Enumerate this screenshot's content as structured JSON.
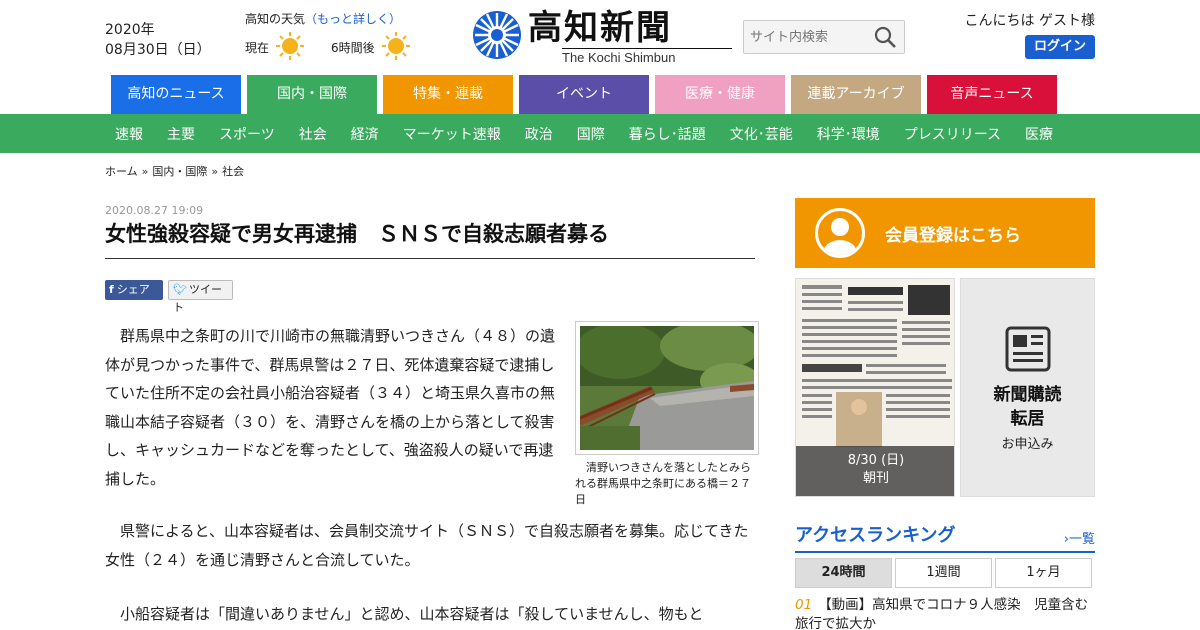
{
  "header": {
    "date_year": "2020年",
    "date_day": "08月30日（日）",
    "weather_title": "高知の天気",
    "weather_more": "（もっと詳しく）",
    "weather_now": "現在",
    "weather_later": "6時間後",
    "weather_icon": "sun-icon",
    "logo_text": "高知新聞",
    "logo_sub": "The Kochi Shimbun",
    "search_placeholder": "サイト内検索",
    "greeting": "こんにちは ゲスト様",
    "login_label": "ログイン"
  },
  "categories": [
    {
      "label": "高知のニュース",
      "color": "#1a6fe8",
      "width": 130
    },
    {
      "label": "国内・国際",
      "color": "#3aaa5e",
      "width": 130
    },
    {
      "label": "特集・連載",
      "color": "#f29600",
      "width": 130
    },
    {
      "label": "イベント",
      "color": "#5a4ea8",
      "width": 130
    },
    {
      "label": "医療・健康",
      "color": "#f0a0c0",
      "width": 130
    },
    {
      "label": "連載アーカイブ",
      "color": "#c4a882",
      "width": 130
    },
    {
      "label": "音声ニュース",
      "color": "#d9103a",
      "width": 130
    }
  ],
  "subnav": [
    "速報",
    "主要",
    "スポーツ",
    "社会",
    "経済",
    "マーケット速報",
    "政治",
    "国際",
    "暮らし･話題",
    "文化･芸能",
    "科学･環境",
    "プレスリリース",
    "医療"
  ],
  "breadcrumb": [
    "ホーム",
    "国内・国際",
    "社会"
  ],
  "article": {
    "date": "2020.08.27 19:09",
    "title": "女性強殺容疑で男女再逮捕　ＳＮＳで自殺志願者募る",
    "share_fb": "シェア",
    "share_tw": "ツイート",
    "p1": "　群馬県中之条町の川で川崎市の無職清野いつきさん（４８）の遺体が見つかった事件で、群馬県警は２７日、死体遺棄容疑で逮捕していた住所不定の会社員小船治容疑者（３４）と埼玉県久喜市の無職山本結子容疑者（３０）を、清野さんを橋の上から落として殺害し、キャッシュカードなどを奪ったとして、強盗殺人の疑いで再逮捕した。",
    "caption": "清野いつきさんを落としたとみられる群馬県中之条町にある橋＝２７日",
    "p2": "　県警によると、山本容疑者は、会員制交流サイト（ＳＮＳ）で自殺志願者を募集。応じてきた女性（２４）を通じ清野さんと合流していた。",
    "p3": "　小船容疑者は「間違いありません」と認め、山本容疑者は「殺していませんし、物もと"
  },
  "sidebar": {
    "member_label": "会員登録はこちら",
    "paper_date": "8/30 (日)",
    "paper_edition": "朝刊",
    "subscribe_title1": "新聞購読",
    "subscribe_title2": "転居",
    "subscribe_sub": "お申込み",
    "ranking_title": "アクセスランキング",
    "ranking_more": "一覧",
    "ranking_tabs": [
      "24時間",
      "1週間",
      "1ヶ月"
    ],
    "ranking_items": [
      {
        "num": "01",
        "text": "【動画】高知県でコロナ９人感染　児童含む　旅行で拡大か"
      }
    ]
  }
}
